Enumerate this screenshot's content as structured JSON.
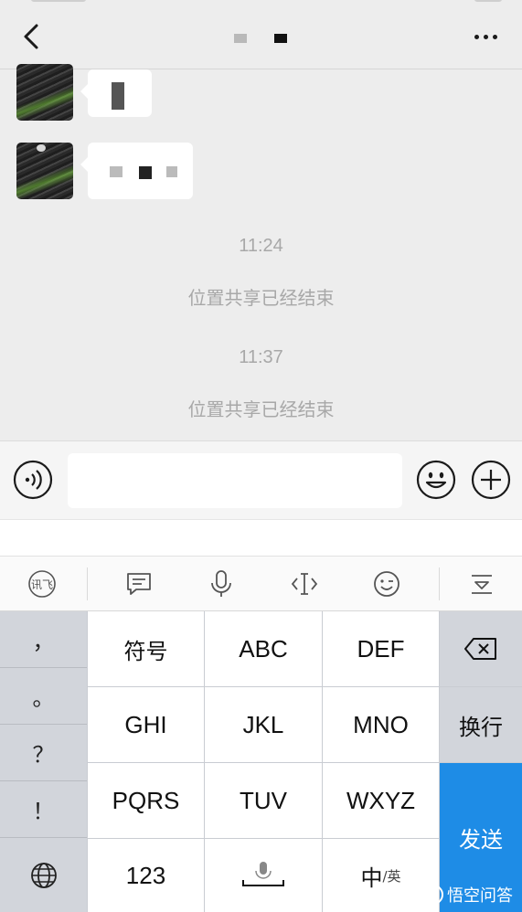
{
  "chat": {
    "messages": [
      {
        "type": "time",
        "text": "11:24"
      },
      {
        "type": "system",
        "text": "位置共享已经结束"
      },
      {
        "type": "time",
        "text": "11:37"
      },
      {
        "type": "system",
        "text": "位置共享已经结束"
      }
    ]
  },
  "input": {
    "value": "",
    "placeholder": ""
  },
  "ime_toolbar": {
    "tools": [
      "ifly-logo-icon",
      "message-icon",
      "microphone-icon",
      "cursor-icon",
      "emoji-wink-icon",
      "collapse-keyboard-icon"
    ],
    "logo_text": "讯飞"
  },
  "keyboard": {
    "punctuation": [
      "，",
      "。",
      "？",
      "！"
    ],
    "rows": [
      [
        "符号",
        "ABC",
        "DEF"
      ],
      [
        "GHI",
        "JKL",
        "MNO"
      ],
      [
        "PQRS",
        "TUV",
        "WXYZ"
      ],
      [
        "123",
        "",
        "中"
      ]
    ],
    "lang_sub": "/英",
    "newline_label": "换行",
    "send_label": "发送",
    "accent": "#1e8ce6"
  },
  "watermark": {
    "text": "悟空问答",
    "logo": "悟"
  }
}
